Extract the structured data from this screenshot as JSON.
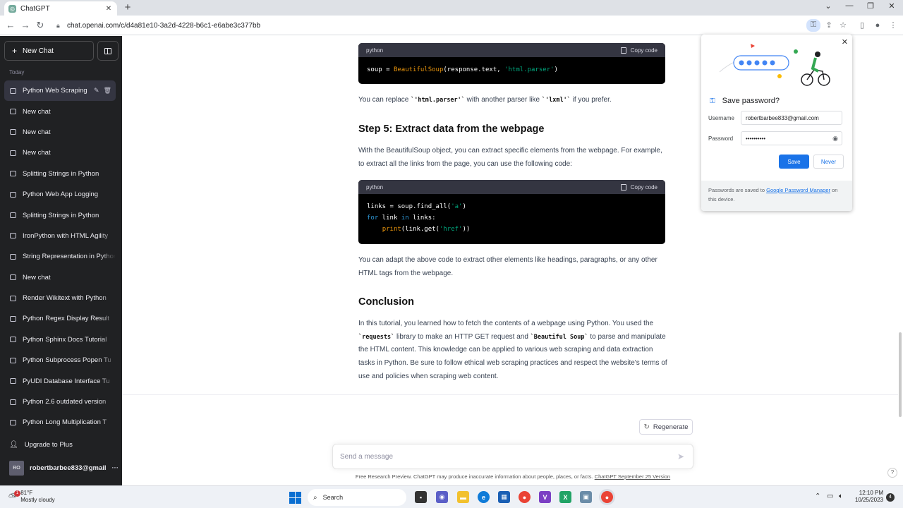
{
  "browser": {
    "tab_title": "ChatGPT",
    "tab_close": "✕",
    "new_tab": "+",
    "url": "chat.openai.com/c/d4a81e10-3a2d-4228-b6c1-e6abe3c377bb"
  },
  "sidebar": {
    "new_chat": "New Chat",
    "section_label": "Today",
    "items": [
      {
        "label": "Python Web Scraping",
        "active": true
      },
      {
        "label": "New chat"
      },
      {
        "label": "New chat"
      },
      {
        "label": "New chat"
      },
      {
        "label": "Splitting Strings in Python"
      },
      {
        "label": "Python Web App Logging"
      },
      {
        "label": "Splitting Strings in Python"
      },
      {
        "label": "IronPython with HTML Agility"
      },
      {
        "label": "String Representation in Python"
      },
      {
        "label": "New chat"
      },
      {
        "label": "Render Wikitext with Python"
      },
      {
        "label": "Python Regex Display Result"
      },
      {
        "label": "Python Sphinx Docs Tutorial"
      },
      {
        "label": "Python Subprocess Popen Tu"
      },
      {
        "label": "PyUDI Database Interface Tu"
      },
      {
        "label": "Python 2.6 outdated version"
      },
      {
        "label": "Python Long Multiplication T"
      }
    ],
    "upgrade": "Upgrade to Plus",
    "user_initials": "RO",
    "user_email": "robertbarbee833@gmail",
    "user_menu": "···"
  },
  "content": {
    "code1_lang": "python",
    "copy_label": "Copy code",
    "code1": "soup = BeautifulSoup(response.text, 'html.parser')",
    "para1_a": "You can replace ",
    "para1_code1": "`'html.parser'`",
    "para1_b": " with another parser like ",
    "para1_code2": "`'lxml'`",
    "para1_c": " if you prefer.",
    "heading1": "Step 5: Extract data from the webpage",
    "para2": "With the BeautifulSoup object, you can extract specific elements from the webpage. For example, to extract all the links from the page, you can use the following code:",
    "code2_lang": "python",
    "code2_line1": "links = soup.find_all('a')",
    "code2_line2": "for link in links:",
    "code2_line3": "    print(link.get('href'))",
    "para3": "You can adapt the above code to extract other elements like headings, paragraphs, or any other HTML tags from the webpage.",
    "heading2": "Conclusion",
    "para4_a": "In this tutorial, you learned how to fetch the contents of a webpage using Python. You used the ",
    "para4_code1": "`requests`",
    "para4_b": " library to make an HTTP GET request and ",
    "para4_code2": "`Beautiful Soup`",
    "para4_c": " to parse and manipulate the HTML content. This knowledge can be applied to various web scraping and data extraction tasks in Python. Be sure to follow ethical web scraping practices and respect the website's terms of use and policies when scraping web content.",
    "regenerate": "Regenerate",
    "message_placeholder": "Send a message",
    "footer_text": "Free Research Preview. ChatGPT may produce inaccurate information about people, places, or facts. ",
    "footer_link": "ChatGPT September 25 Version",
    "help": "?"
  },
  "password_popup": {
    "title": "Save password?",
    "username_label": "Username",
    "username_value": "robertbarbee833@gmail.com",
    "password_label": "Password",
    "password_value": "••••••••••",
    "save": "Save",
    "never": "Never",
    "footer_a": "Passwords are saved to ",
    "footer_link": "Google Password Manager",
    "footer_b": " on this device."
  },
  "taskbar": {
    "temp": "81°F",
    "weather": "Mostly cloudy",
    "weather_badge": "1",
    "search": "Search",
    "time": "12:10 PM",
    "date": "10/25/2023",
    "notifications": "4"
  },
  "colors": {
    "sidebar_bg": "#202123",
    "accent_blue": "#1a73e8",
    "code_bg": "#000000"
  }
}
